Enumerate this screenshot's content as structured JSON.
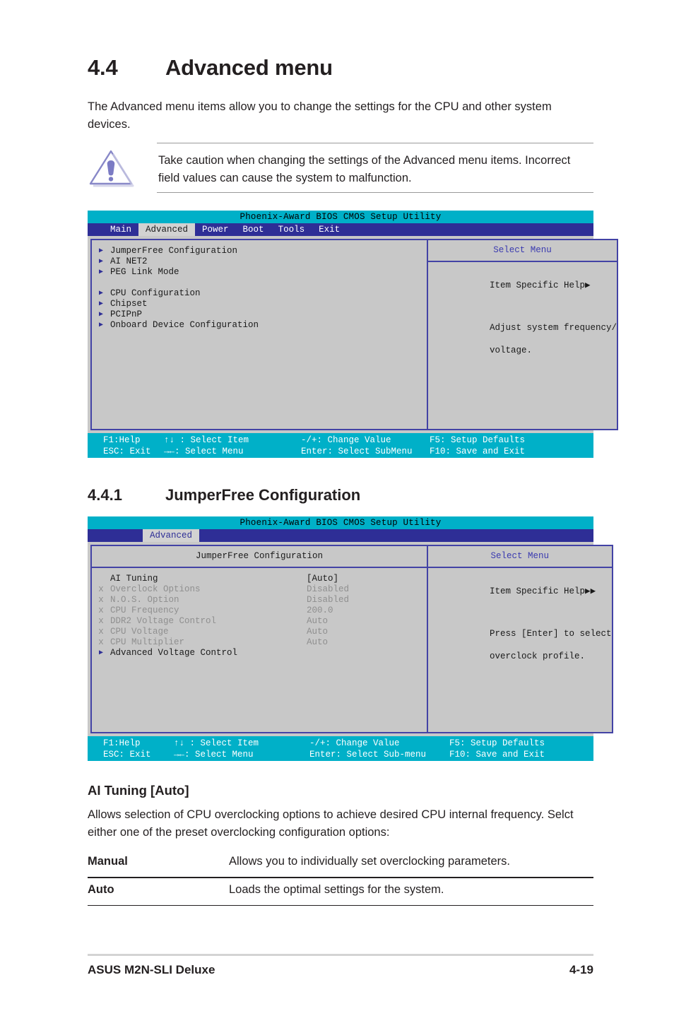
{
  "section": {
    "number": "4.4",
    "title": "Advanced menu",
    "intro": "The Advanced menu items allow you to change the settings for the CPU and other system devices."
  },
  "caution": {
    "icon": "warning-triangle-icon",
    "text": "Take caution when changing the settings of the Advanced menu items. Incorrect field values can cause the system to malfunction."
  },
  "bios_screen_1": {
    "title": "Phoenix-Award BIOS CMOS Setup Utility",
    "tabs": [
      {
        "label": "Main",
        "active": false
      },
      {
        "label": "Advanced",
        "active": true
      },
      {
        "label": "Power",
        "active": false
      },
      {
        "label": "Boot",
        "active": false
      },
      {
        "label": "Tools",
        "active": false
      },
      {
        "label": "Exit",
        "active": false
      }
    ],
    "menu_items": [
      {
        "bullet": "arrow",
        "label": "JumperFree Configuration"
      },
      {
        "bullet": "arrow",
        "label": "AI NET2"
      },
      {
        "bullet": "arrow",
        "label": "PEG Link Mode"
      },
      {
        "bullet": "none",
        "label": ""
      },
      {
        "bullet": "arrow",
        "label": "CPU Configuration"
      },
      {
        "bullet": "arrow",
        "label": "Chipset"
      },
      {
        "bullet": "arrow",
        "label": "PCIPnP"
      },
      {
        "bullet": "arrow",
        "label": "Onboard Device Configuration"
      }
    ],
    "help": {
      "title": "Select Menu",
      "heading": "Item Specific Help",
      "body_line1": "Adjust system frequency/",
      "body_line2": "voltage."
    },
    "footer": {
      "f1": "F1:Help",
      "select_item": "↑↓ : Select Item",
      "change_value": "-/+: Change Value",
      "setup_defaults": "F5: Setup Defaults",
      "esc": "ESC: Exit",
      "select_menu": "→←: Select Menu",
      "enter": "Enter: Select SubMenu",
      "save_exit": "F10: Save and Exit"
    }
  },
  "subsection": {
    "number": "4.4.1",
    "title": "JumperFree Configuration"
  },
  "bios_screen_2": {
    "title": "Phoenix-Award BIOS CMOS Setup Utility",
    "tabs": [
      {
        "label": "",
        "active": false
      },
      {
        "label": "Advanced",
        "active": true
      },
      {
        "label": "",
        "active": false
      }
    ],
    "panel_title": "JumperFree Configuration",
    "menu_items": [
      {
        "bullet": "none",
        "label": "AI Tuning",
        "value": "[Auto]",
        "dim": false
      },
      {
        "bullet": "x",
        "label": "Overclock Options",
        "value": "Disabled",
        "dim": true
      },
      {
        "bullet": "x",
        "label": "N.O.S. Option",
        "value": "Disabled",
        "dim": true
      },
      {
        "bullet": "x",
        "label": "CPU Frequency",
        "value": "200.0",
        "dim": true
      },
      {
        "bullet": "x",
        "label": "DDR2 Voltage Control",
        "value": "Auto",
        "dim": true
      },
      {
        "bullet": "x",
        "label": "CPU Voltage",
        "value": "Auto",
        "dim": true
      },
      {
        "bullet": "x",
        "label": "CPU Multiplier",
        "value": "Auto",
        "dim": true
      },
      {
        "bullet": "arrow",
        "label": "Advanced Voltage Control",
        "value": "",
        "dim": false
      }
    ],
    "help": {
      "title": "Select Menu",
      "heading": "Item Specific Help",
      "body_line1": "Press [Enter] to select",
      "body_line2": "overclock profile."
    },
    "footer": {
      "f1": "F1:Help",
      "select_item": "↑↓ : Select Item",
      "change_value": "-/+: Change Value",
      "setup_defaults": "F5: Setup Defaults",
      "esc": "ESC: Exit",
      "select_menu": "→←: Select Menu",
      "enter": "Enter: Select Sub-menu",
      "save_exit": "F10: Save and Exit"
    }
  },
  "ai_tuning": {
    "heading": "AI Tuning [Auto]",
    "description": "Allows selection of CPU overclocking options to achieve desired CPU internal frequency. Selct either one of the preset overclocking configuration options:",
    "options": [
      {
        "term": "Manual",
        "definition": "Allows you to individually set overclocking parameters."
      },
      {
        "term": "Auto",
        "definition": "Loads the optimal settings for the system."
      }
    ]
  },
  "page_footer": {
    "left": "ASUS M2N-SLI Deluxe",
    "right": "4-19"
  },
  "colors": {
    "bios_title_bar": "#00b0c8",
    "bios_tab_bar": "#2e2e96",
    "bios_panel_bg": "#c8c8c8",
    "bios_border": "#4343a5",
    "help_title": "#3a3ab0",
    "dim_text": "#8f8f8f",
    "caution_icon": "#7b7bc4"
  }
}
